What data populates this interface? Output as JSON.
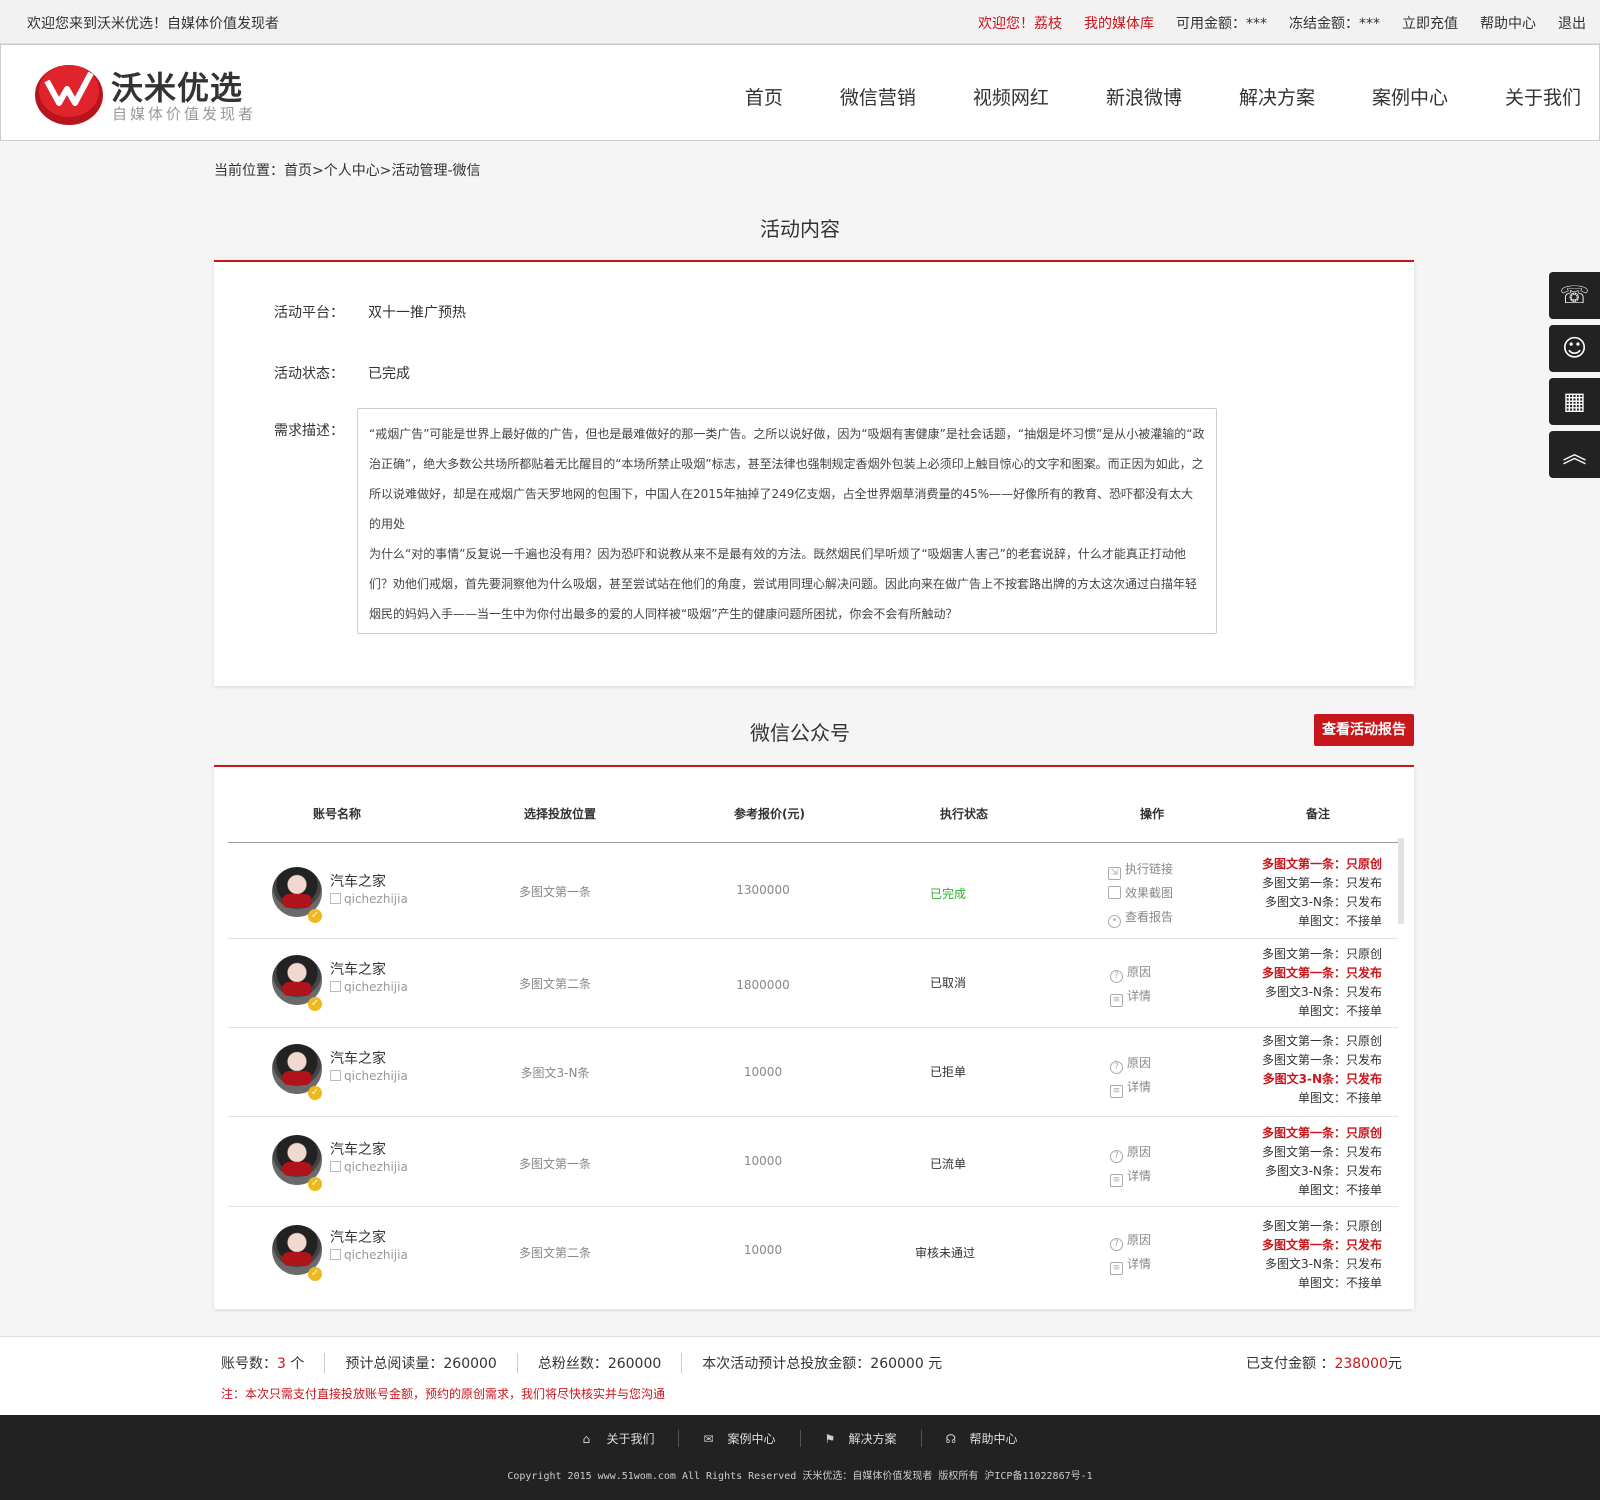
{
  "topbar": {
    "welcome": "欢迎您来到沃米优选！自媒体价值发现者",
    "greeting": "欢迎您！荔枝",
    "media_lib": "我的媒体库",
    "available": "可用金额：***",
    "frozen": "冻结金额：***",
    "recharge": "立即充值",
    "help": "帮助中心",
    "logout": "退出"
  },
  "header": {
    "logo_title": "沃米优选",
    "logo_sub": "自媒体价值发现者",
    "nav": [
      "首页",
      "微信营销",
      "视频网红",
      "新浪微博",
      "解决方案",
      "案例中心",
      "关于我们"
    ]
  },
  "breadcrumb": "当前位置：首页>个人中心>活动管理-微信",
  "activity": {
    "title": "活动内容",
    "platform_label": "活动平台：",
    "platform_value": "双十一推广预热",
    "status_label": "活动状态：",
    "status_value": "已完成",
    "desc_label": "需求描述：",
    "desc_p1": "“戒烟广告”可能是世界上最好做的广告，但也是最难做好的那一类广告。之所以说好做，因为“吸烟有害健康”是社会话题，“抽烟是坏习惯”是从小被灌输的“政治正确”，绝大多数公共场所都贴着无比醒目的“本场所禁止吸烟”标志，甚至法律也强制规定香烟外包装上必须印上触目惊心的文字和图案。而正因为如此，之所以说难做好，却是在戒烟广告天罗地网的包围下，中国人在2015年抽掉了249亿支烟，占全世界烟草消费量的45%——好像所有的教育、恐吓都没有太大的用处",
    "desc_p2": "为什么“对的事情”反复说一千遍也没有用？因为恐吓和说教从来不是最有效的方法。既然烟民们早听烦了“吸烟害人害己”的老套说辞，什么才能真正打动他们？劝他们戒烟，首先要洞察他为什么吸烟，甚至尝试站在他们的角度，尝试用同理心解决问题。因此向来在做广告上不按套路出牌的方太这次通过白描年轻烟民的妈妈入手——当一生中为你付出最多的爱的人同样被“吸烟”产生的健康问题所困扰，你会不会有所触动？"
  },
  "wechat": {
    "title": "微信公众号",
    "report_button": "查看活动报告",
    "columns": [
      "账号名称",
      "选择投放位置",
      "参考报价(元)",
      "执行状态",
      "操作",
      "备注"
    ],
    "rows": [
      {
        "name": "汽车之家",
        "id": "qichezhijia",
        "position": "多图文第一条",
        "price": "1300000",
        "status": "已完成",
        "ops": [
          "执行链接",
          "效果截图",
          "查看报告"
        ],
        "notes": [
          "多图文第一条：只原创",
          "多图文第一条：只发布",
          "多图文3-N条：只发布",
          "单图文：不接单"
        ],
        "highlight": 0
      },
      {
        "name": "汽车之家",
        "id": "qichezhijia",
        "position": "多图文第二条",
        "price": "1800000",
        "status": "已取消",
        "ops": [
          "原因",
          "详情"
        ],
        "notes": [
          "多图文第一条：只原创",
          "多图文第一条：只发布",
          "多图文3-N条：只发布",
          "单图文：不接单"
        ],
        "highlight": 1
      },
      {
        "name": "汽车之家",
        "id": "qichezhijia",
        "position": "多图文3-N条",
        "price": "10000",
        "status": "已拒单",
        "ops": [
          "原因",
          "详情"
        ],
        "notes": [
          "多图文第一条：只原创",
          "多图文第一条：只发布",
          "多图文3-N条：只发布",
          "单图文：不接单"
        ],
        "highlight": 2
      },
      {
        "name": "汽车之家",
        "id": "qichezhijia",
        "position": "多图文第一条",
        "price": "10000",
        "status": "已流单",
        "ops": [
          "原因",
          "详情"
        ],
        "notes": [
          "多图文第一条：只原创",
          "多图文第一条：只发布",
          "多图文3-N条：只发布",
          "单图文：不接单"
        ],
        "highlight": 0
      },
      {
        "name": "汽车之家",
        "id": "qichezhijia",
        "position": "多图文第二条",
        "price": "10000",
        "status": "审核未通过",
        "ops": [
          "原因",
          "详情"
        ],
        "notes": [
          "多图文第一条：只原创",
          "多图文第一条：只发布",
          "多图文3-N条：只发布",
          "单图文：不接单"
        ],
        "highlight": 1
      }
    ]
  },
  "summary": {
    "count_label": "账号数：",
    "count_value": "3",
    "count_unit": "个",
    "reads": "预计总阅读量：260000",
    "fans": "总粉丝数：260000",
    "total": "本次活动预计总投放金额：260000 元",
    "paid_label": "已支付金额 ：",
    "paid_value": "238000",
    "paid_unit": "元",
    "note": "注：本次只需支付直接投放账号金额，预约的原创需求，我们将尽快核实并与您沟通"
  },
  "footer": {
    "links": [
      "关于我们",
      "案例中心",
      "解决方案",
      "帮助中心"
    ],
    "copyright": "Copyright 2015 www.51wom.com All Rights Reserved 沃米优选：自媒体价值发现者 版权所有 沪ICP备11022867号-1"
  },
  "colors": {
    "accent": "#c8161d",
    "done": "#2cb02c",
    "footer_bg": "#222222"
  }
}
